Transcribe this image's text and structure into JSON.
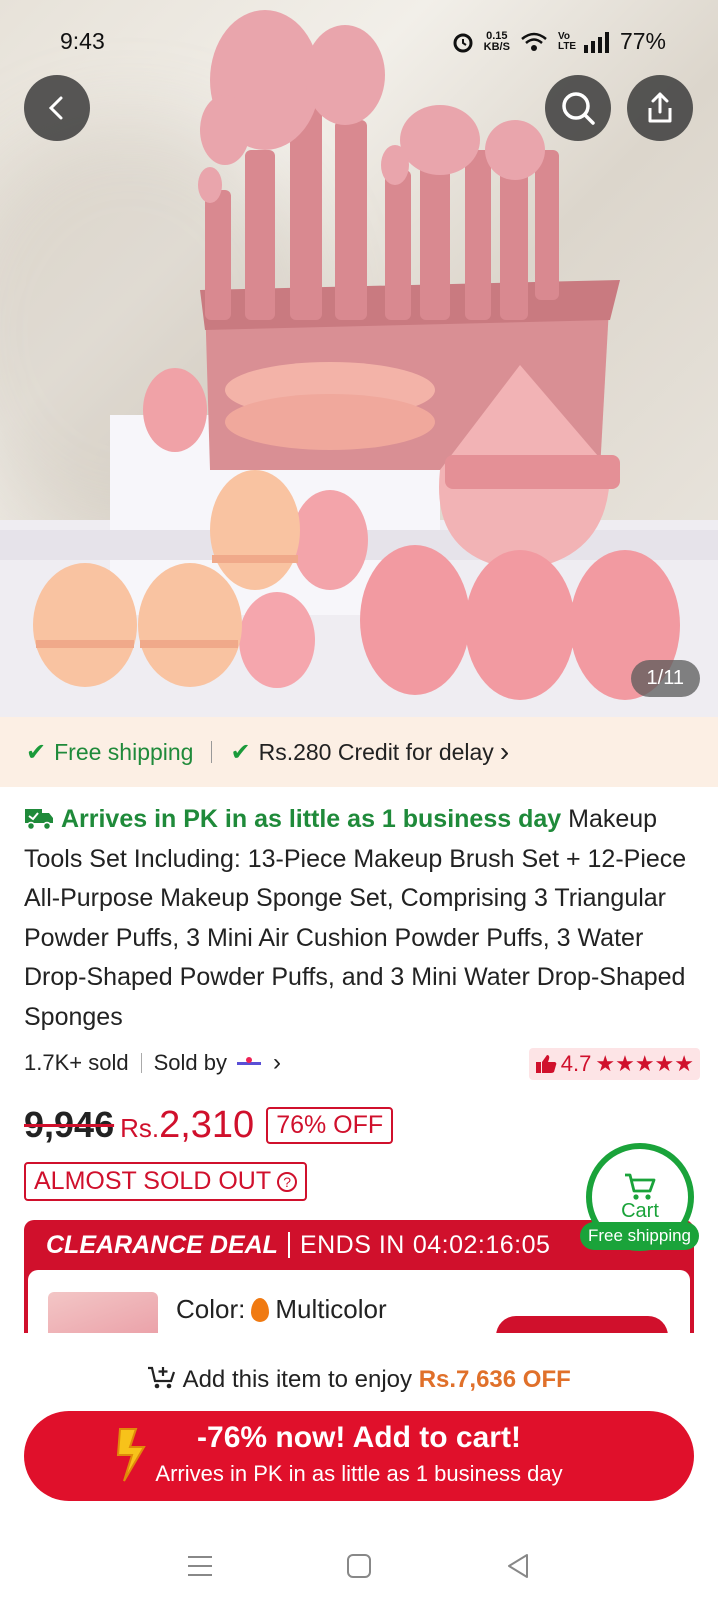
{
  "status_bar": {
    "time": "9:43",
    "net_speed_value": "0.15",
    "net_speed_unit": "KB/S",
    "volte": "Vo LTE",
    "battery": "77%"
  },
  "hero": {
    "image_counter": "1/11"
  },
  "shipping": {
    "free_shipping": "Free shipping",
    "credit": "Rs.280 Credit for delay",
    "credit_chevron": "›"
  },
  "product": {
    "arrives": "Arrives in PK in as little as 1 business day",
    "title": "Makeup Tools Set Including: 13-Piece Makeup Brush Set + 12-Piece All-Purpose Makeup Sponge Set, Comprising 3 Triangular Powder Puffs, 3 Mini Air Cushion Powder Puffs, 3 Water Drop-Shaped Powder Puffs, and 3 Mini Water Drop-Shaped Sponges",
    "sold_count": "1.7K+ sold",
    "sold_by": "Sold by",
    "rating": "4.7",
    "stars": "★★★★★"
  },
  "price": {
    "old": "9,946",
    "currency": "Rs.",
    "new": "2,310",
    "discount": "76% OFF",
    "almost_sold_out": "ALMOST SOLD OUT"
  },
  "floating_cart": {
    "label": "Cart",
    "free_shipping": "Free shipping"
  },
  "deal": {
    "title": "CLEARANCE DEAL",
    "ends_label": "ENDS IN",
    "countdown": "04:02:16:05",
    "color_label": "Color:",
    "color_value": "Multicolor"
  },
  "bottom": {
    "enjoy_prefix": "Add this item to enjoy",
    "enjoy_amount": "Rs.7,636 OFF",
    "cta_line1": "-76% now! Add to cart!",
    "cta_line2": "Arrives in PK in as little as 1 business day"
  },
  "colors": {
    "brand_red": "#d0102c",
    "green": "#1a9a3a",
    "orange": "#e0702a"
  },
  "icons": [
    "back-arrow-icon",
    "search-icon",
    "share-icon",
    "cart-icon",
    "thumbs-up-icon",
    "truck-icon",
    "lightning-icon",
    "menu-icon",
    "home-icon",
    "back-triangle-icon"
  ]
}
